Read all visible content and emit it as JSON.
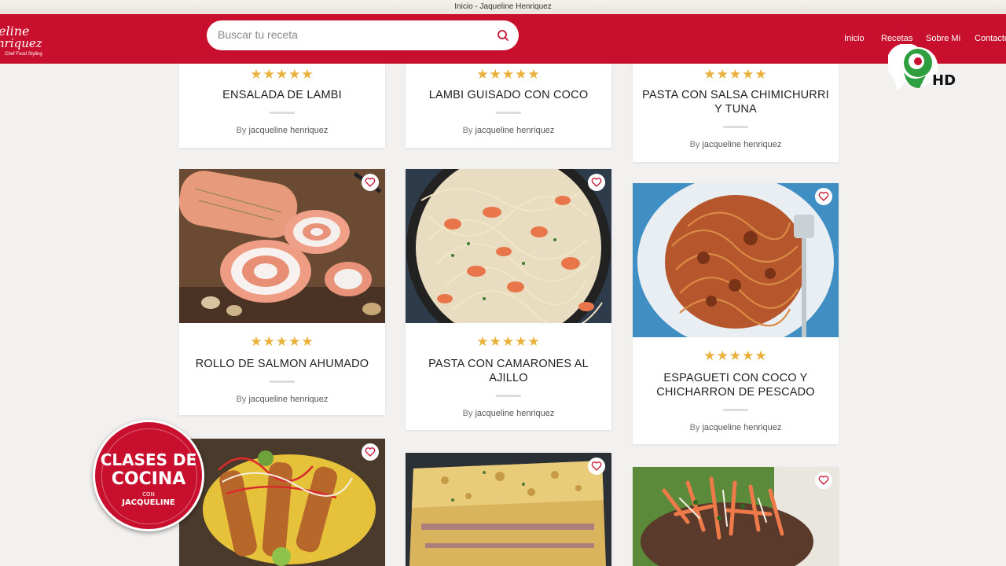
{
  "window": {
    "title": "Inicio - Jaqueline Henriquez"
  },
  "header": {
    "logo_line1": "eline",
    "logo_line2": "nriquez",
    "logo_tagline": "Chef Food Styling",
    "search_placeholder": "Buscar tu receta",
    "nav": [
      "Inicio",
      "Recetas",
      "Sobre Mi",
      "Contacto"
    ]
  },
  "rating_text": "★★★★★",
  "byline_prefix": "By",
  "cards": [
    {
      "title": "ENSALADA DE LAMBI",
      "author": "jacqueline henriquez"
    },
    {
      "title": "LAMBI GUISADO CON COCO",
      "author": "jacqueline henriquez"
    },
    {
      "title": "PASTA CON SALSA CHIMICHURRI Y TUNA",
      "author": "jacqueline henriquez"
    },
    {
      "title": "ROLLO DE SALMON AHUMADO",
      "author": "jacqueline henriquez"
    },
    {
      "title": "PASTA CON CAMARONES AL AJILLO",
      "author": "jacqueline henriquez"
    },
    {
      "title": "ESPAGUETI CON COCO Y CHICHARRON DE PESCADO",
      "author": "jacqueline henriquez"
    }
  ],
  "overlay": {
    "channel_hd": "HD",
    "badge_line1": "CLASES DE",
    "badge_line2": "COCINA",
    "badge_con": "CON",
    "badge_name": "JACQUELINE"
  },
  "colors": {
    "brand_red": "#c8102e",
    "star": "#e9b03a",
    "background": "#f3f1ef"
  },
  "icons": [
    "search-icon",
    "heart-icon",
    "star-icon",
    "channel-9-logo"
  ]
}
